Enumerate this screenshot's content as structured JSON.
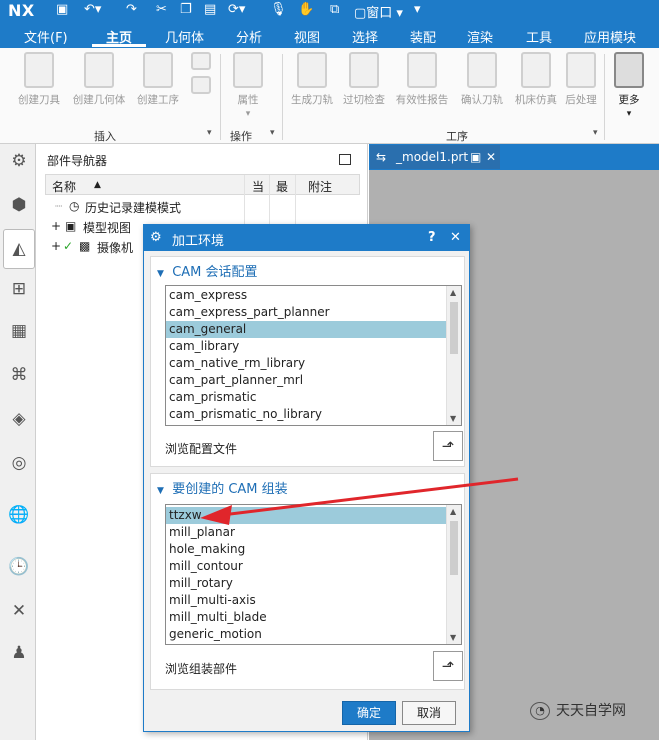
{
  "app": {
    "logo": "NX"
  },
  "menubar": {
    "items": [
      "文件(F)",
      "主页",
      "几何体",
      "分析",
      "视图",
      "选择",
      "装配",
      "渲染",
      "工具",
      "应用模块"
    ],
    "active": "主页"
  },
  "ribbon": {
    "buttons": [
      "创建刀具",
      "创建几何体",
      "创建工序",
      "属性",
      "生成刀轨",
      "过切检查",
      "有效性报告",
      "确认刀轨",
      "机床仿真",
      "后处理",
      "更多"
    ],
    "groups": {
      "insert": "插入",
      "operation": "操作",
      "procedure": "工序"
    }
  },
  "navigator": {
    "title": "部件导航器",
    "columns": [
      "名称",
      "当",
      "最",
      "附注"
    ],
    "rows": [
      "历史记录建模模式",
      "模型视图",
      "摄像机"
    ]
  },
  "doctab": {
    "label": "_model1.prt"
  },
  "dialog": {
    "title": "加工环境",
    "section1": {
      "title": "CAM 会话配置",
      "items": [
        "cam_express",
        "cam_express_part_planner",
        "cam_general",
        "cam_library",
        "cam_native_rm_library",
        "cam_part_planner_mrl",
        "cam_prismatic",
        "cam_prismatic_no_library"
      ],
      "selected": "cam_general",
      "browse_label": "浏览配置文件"
    },
    "section2": {
      "title": "要创建的 CAM 组装",
      "items": [
        "ttzxw",
        "mill_planar",
        "hole_making",
        "mill_contour",
        "mill_rotary",
        "mill_multi-axis",
        "mill_multi_blade",
        "generic_motion"
      ],
      "selected": "ttzxw",
      "browse_label": "浏览组装部件"
    },
    "ok_label": "确定",
    "cancel_label": "取消",
    "help_label": "?",
    "close_label": "✕"
  },
  "watermark": {
    "text": "天天自学网"
  },
  "colors": {
    "accent": "#1e7bc8",
    "selection": "#9ccbdb",
    "arrow": "#e0262b"
  }
}
